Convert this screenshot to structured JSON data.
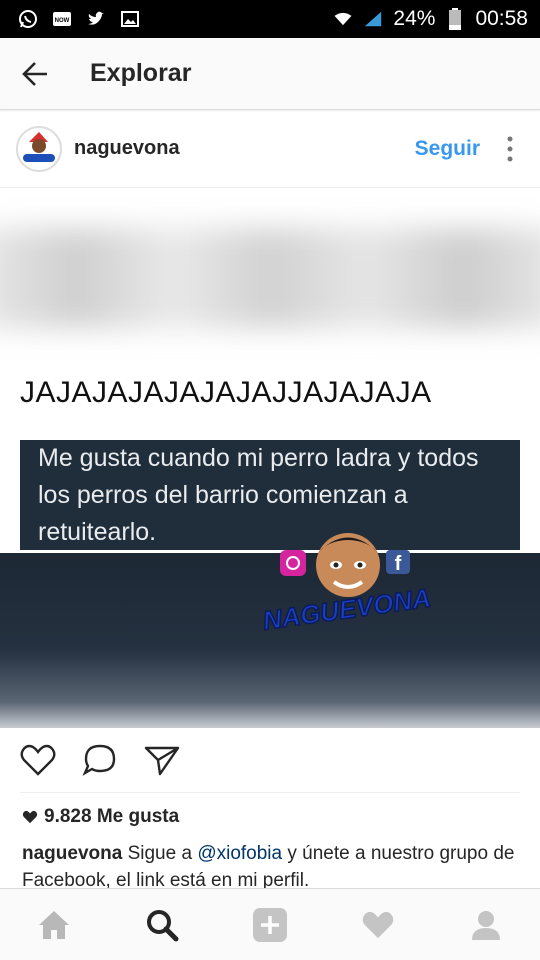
{
  "status_bar": {
    "battery_percent": "24%",
    "time": "00:58",
    "left_icons": [
      "whatsapp-icon",
      "now-icon",
      "twitter-icon",
      "gallery-icon"
    ]
  },
  "header": {
    "title": "Explorar"
  },
  "post": {
    "username": "naguevona",
    "follow_label": "Seguir",
    "image": {
      "title_text": "JAJAJAJAJAJAJAJJAJAJAJA",
      "tweet_text": "Me gusta cuando mi perro ladra y todos los perros del barrio comienzan a retuitearlo.",
      "watermark_text": "NAGUEVONA"
    },
    "likes_text": "9.828 Me gusta",
    "caption": {
      "user": "naguevona",
      "part1": " Sigue a ",
      "mention": "@xiofobia",
      "part2": " y únete a nuestro grupo de Facebook, el link está en mi perfil."
    }
  },
  "colors": {
    "link_blue": "#3897f0",
    "tweet_bg": "#202d3a",
    "status_bar_bg": "#000000"
  },
  "bottom_nav": [
    "home-icon",
    "search-icon",
    "add-post-icon",
    "activity-heart-icon",
    "profile-icon"
  ]
}
